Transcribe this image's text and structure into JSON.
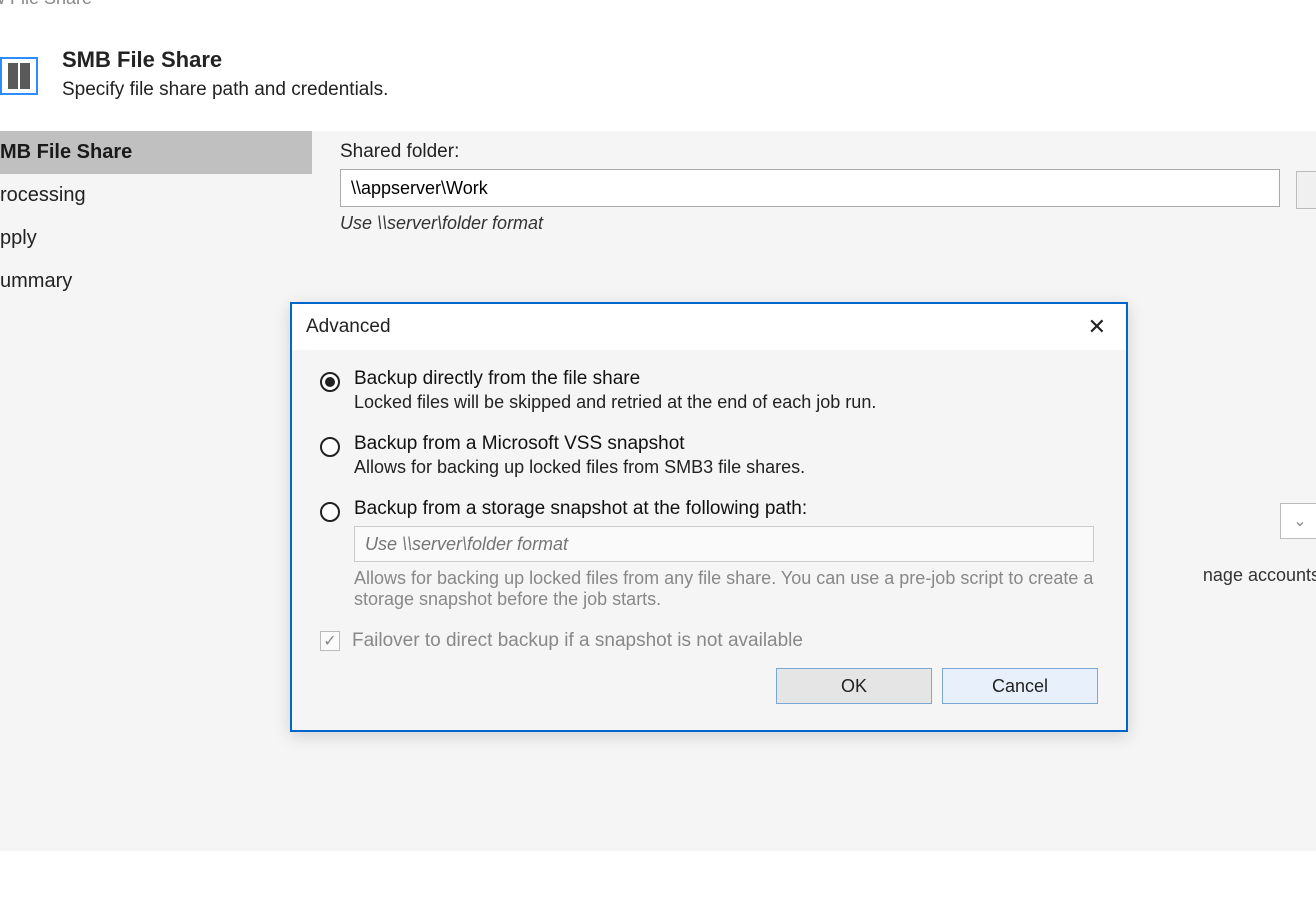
{
  "window_title": "w File Share",
  "header": {
    "title": "SMB File Share",
    "subtitle": "Specify file share path and credentials."
  },
  "sidebar": {
    "items": [
      {
        "label": "MB File Share"
      },
      {
        "label": "rocessing"
      },
      {
        "label": "pply"
      },
      {
        "label": "ummary"
      }
    ]
  },
  "form": {
    "shared_folder_label": "Shared folder:",
    "shared_folder_value": "\\\\appserver\\Work",
    "shared_folder_hint": "Use \\\\server\\folder format",
    "manage_accounts": "nage accounts"
  },
  "dialog": {
    "title": "Advanced",
    "options": [
      {
        "label": "Backup directly from the file share",
        "desc": "Locked files will be skipped and retried at the end of each job run."
      },
      {
        "label": "Backup from a Microsoft VSS snapshot",
        "desc": "Allows for backing up locked files from SMB3 file shares."
      },
      {
        "label": "Backup from a storage snapshot at the following path:",
        "path_placeholder": "Use \\\\server\\folder format",
        "desc": "Allows for backing up locked files from any file share. You can use a pre-job script to create a storage snapshot before the job starts."
      }
    ],
    "failover_label": "Failover to direct backup if a snapshot is not available",
    "ok": "OK",
    "cancel": "Cancel"
  }
}
